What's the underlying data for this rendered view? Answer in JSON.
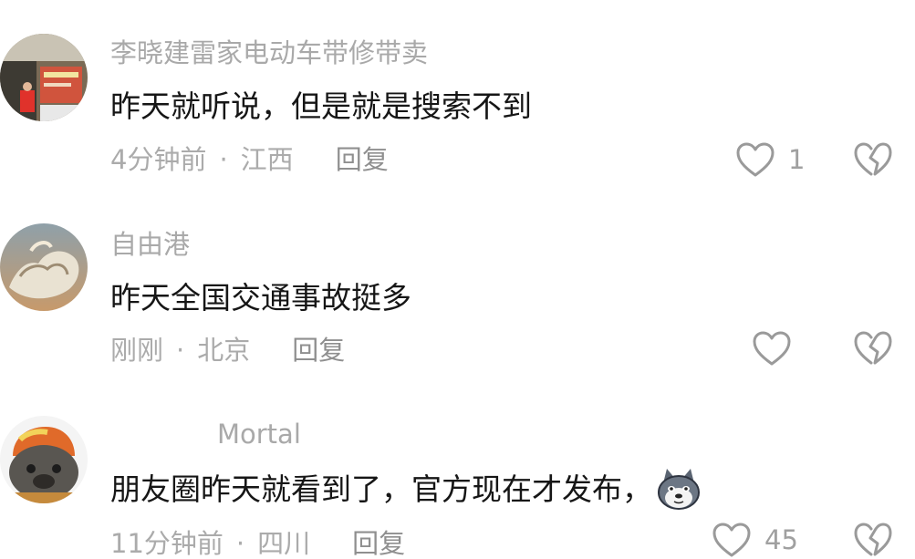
{
  "comments": [
    {
      "username": "李晓建雷家电动车带修带卖",
      "text": "昨天就听说，但是就是搜索不到",
      "time": "4分钟前",
      "location": "江西",
      "separator": "·",
      "reply_label": "回复",
      "likes": "1",
      "avatar_icon": "shop-photo-avatar"
    },
    {
      "username": "自由港",
      "text": "昨天全国交通事故挺多",
      "time": "刚刚",
      "location": "北京",
      "separator": "·",
      "reply_label": "回复",
      "likes": "",
      "avatar_icon": "sky-cloud-avatar"
    },
    {
      "username": "Mortal",
      "text": "朋友圈昨天就看到了，官方现在才发布，",
      "emoji": "husky-dog-emoji",
      "time": "11分钟前",
      "location": "四川",
      "separator": "·",
      "reply_label": "回复",
      "likes": "45",
      "avatar_icon": "cartoon-animal-avatar"
    }
  ],
  "colors": {
    "username": "#a9a9a9",
    "text": "#161616",
    "meta": "#ababab",
    "icon_stroke": "#9a9a9a"
  }
}
